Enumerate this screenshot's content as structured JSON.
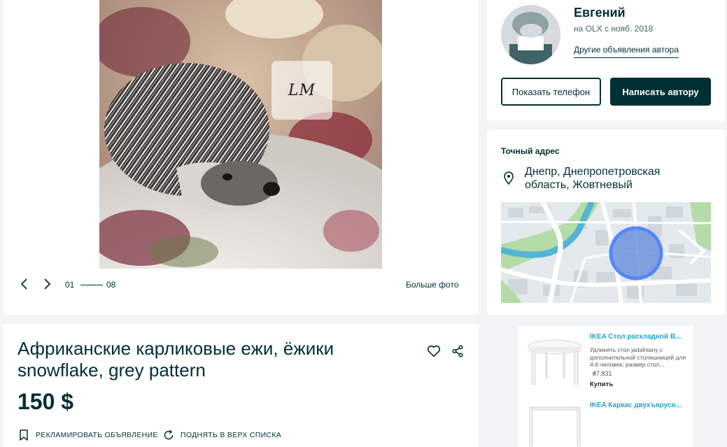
{
  "gallery": {
    "watermark": "LM",
    "counter_current": "01",
    "counter_total": "08",
    "more_photos": "Больше фото",
    "icons": {
      "prev": "chevron-left-icon",
      "next": "chevron-right-icon"
    }
  },
  "listing": {
    "title": "Африканские карликовые ежи, ёжики snowflake, grey pattern",
    "price": "150 $",
    "promote_label": "Рекламировать объявление",
    "raise_label": "Поднять в верх списка",
    "icons": {
      "favorite": "heart-icon",
      "share": "share-icon",
      "promote": "bookmark-icon",
      "raise": "refresh-icon"
    }
  },
  "seller": {
    "name": "Евгений",
    "since": "на OLX с нояб. 2018",
    "other_ads": "Другие объявления автора",
    "phone_button": "Показать телефон",
    "write_button": "Написать автору"
  },
  "location": {
    "heading": "Точный адрес",
    "address": "Днепр, Днепропетровская область, Жовтневый",
    "icon": "location-pin-icon"
  },
  "ads": [
    {
      "title": "IKEA Стол раскладной В...",
      "description": "Удлинять стол jadalniany с дополнительной столешницей для 4-6 человек; размер стол...",
      "price": "₴7,831",
      "buy": "Купить"
    },
    {
      "title": "IKEA Каркас двухъярусн..."
    }
  ],
  "colors": {
    "primary": "#002f34",
    "background": "#f2f4f5",
    "ad_link": "#23a3c7",
    "map_circle": "#3a77ff"
  }
}
